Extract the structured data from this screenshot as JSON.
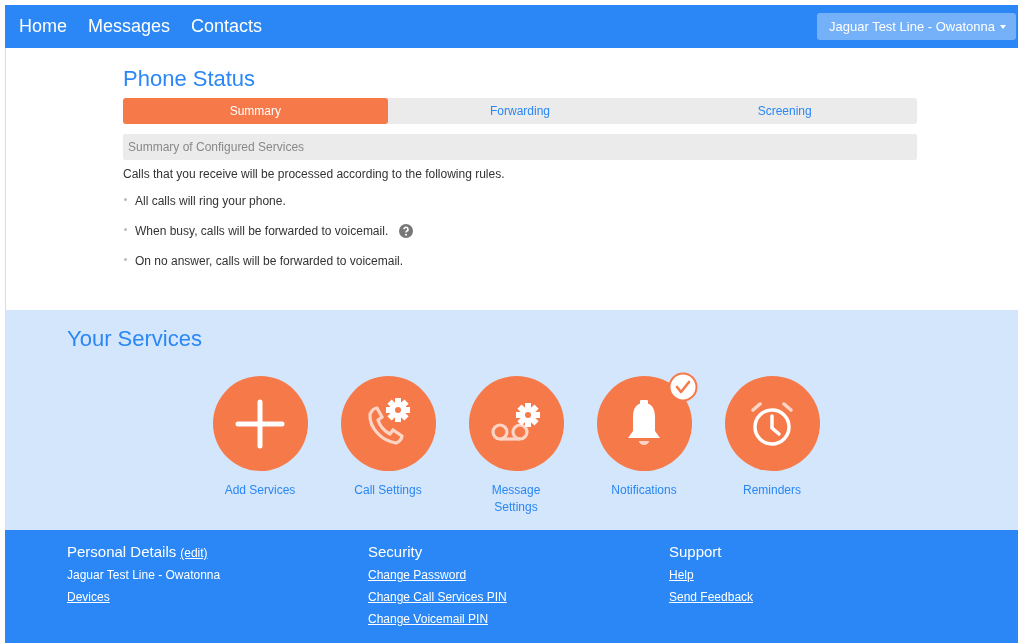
{
  "nav": {
    "items": [
      {
        "label": "Home"
      },
      {
        "label": "Messages"
      },
      {
        "label": "Contacts"
      }
    ],
    "account_menu": {
      "label": "Jaguar Test Line - Owatonna"
    }
  },
  "phone_status": {
    "title": "Phone Status",
    "tabs": [
      {
        "label": "Summary",
        "selected": true
      },
      {
        "label": "Forwarding",
        "selected": false
      },
      {
        "label": "Screening",
        "selected": false
      }
    ],
    "section_header": "Summary of Configured Services",
    "intro": "Calls that you receive will be processed according to the following rules.",
    "rules": [
      {
        "text": "All calls will ring your phone.",
        "help": false
      },
      {
        "text": "When busy, calls will be forwarded to voicemail.",
        "help": true
      },
      {
        "text": "On no answer, calls will be forwarded to voicemail.",
        "help": false
      }
    ]
  },
  "services": {
    "title": "Your Services",
    "items": [
      {
        "kind": "add",
        "label": "Add Services",
        "checked": false
      },
      {
        "kind": "call",
        "label": "Call Settings",
        "checked": false
      },
      {
        "kind": "message",
        "label": "Message Settings",
        "checked": false
      },
      {
        "kind": "notifications",
        "label": "Notifications",
        "checked": true
      },
      {
        "kind": "reminders",
        "label": "Reminders",
        "checked": false
      }
    ]
  },
  "footer": {
    "columns": [
      {
        "title": "Personal Details",
        "title_link": "(edit)",
        "lines": [
          {
            "kind": "text",
            "text": "Jaguar Test Line - Owatonna"
          },
          {
            "kind": "link",
            "text": "Devices"
          }
        ]
      },
      {
        "title": "Security",
        "lines": [
          {
            "kind": "link",
            "text": "Change Password"
          },
          {
            "kind": "link",
            "text": "Change Call Services PIN"
          },
          {
            "kind": "link",
            "text": "Change Voicemail PIN"
          }
        ]
      },
      {
        "title": "Support",
        "lines": [
          {
            "kind": "link",
            "text": "Help"
          },
          {
            "kind": "link",
            "text": "Send Feedback"
          }
        ]
      }
    ]
  }
}
